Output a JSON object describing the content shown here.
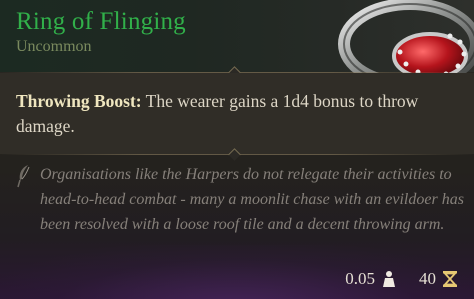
{
  "item": {
    "name": "Ring of Flinging",
    "rarity": "Uncommon",
    "icon": "ring-with-red-gem-icon"
  },
  "effect": {
    "title": "Throwing Boost:",
    "description": " The wearer gains a 1d4 bonus to throw damage."
  },
  "lore": {
    "icon": "quill-icon",
    "text": "Organisations like the Harpers do not relegate their activities to head-to-head combat - many a moonlit chase with an evildoer has been resolved with a loose roof tile and a decent throwing arm."
  },
  "stats": {
    "weight": "0.05",
    "weight_icon": "weight-icon",
    "value": "40",
    "value_icon": "hourglass-value-icon"
  },
  "colors": {
    "name": "#31b04a",
    "rarity": "#7a8a5e",
    "effect_title": "#efe6bf",
    "lore": "#86807a"
  }
}
